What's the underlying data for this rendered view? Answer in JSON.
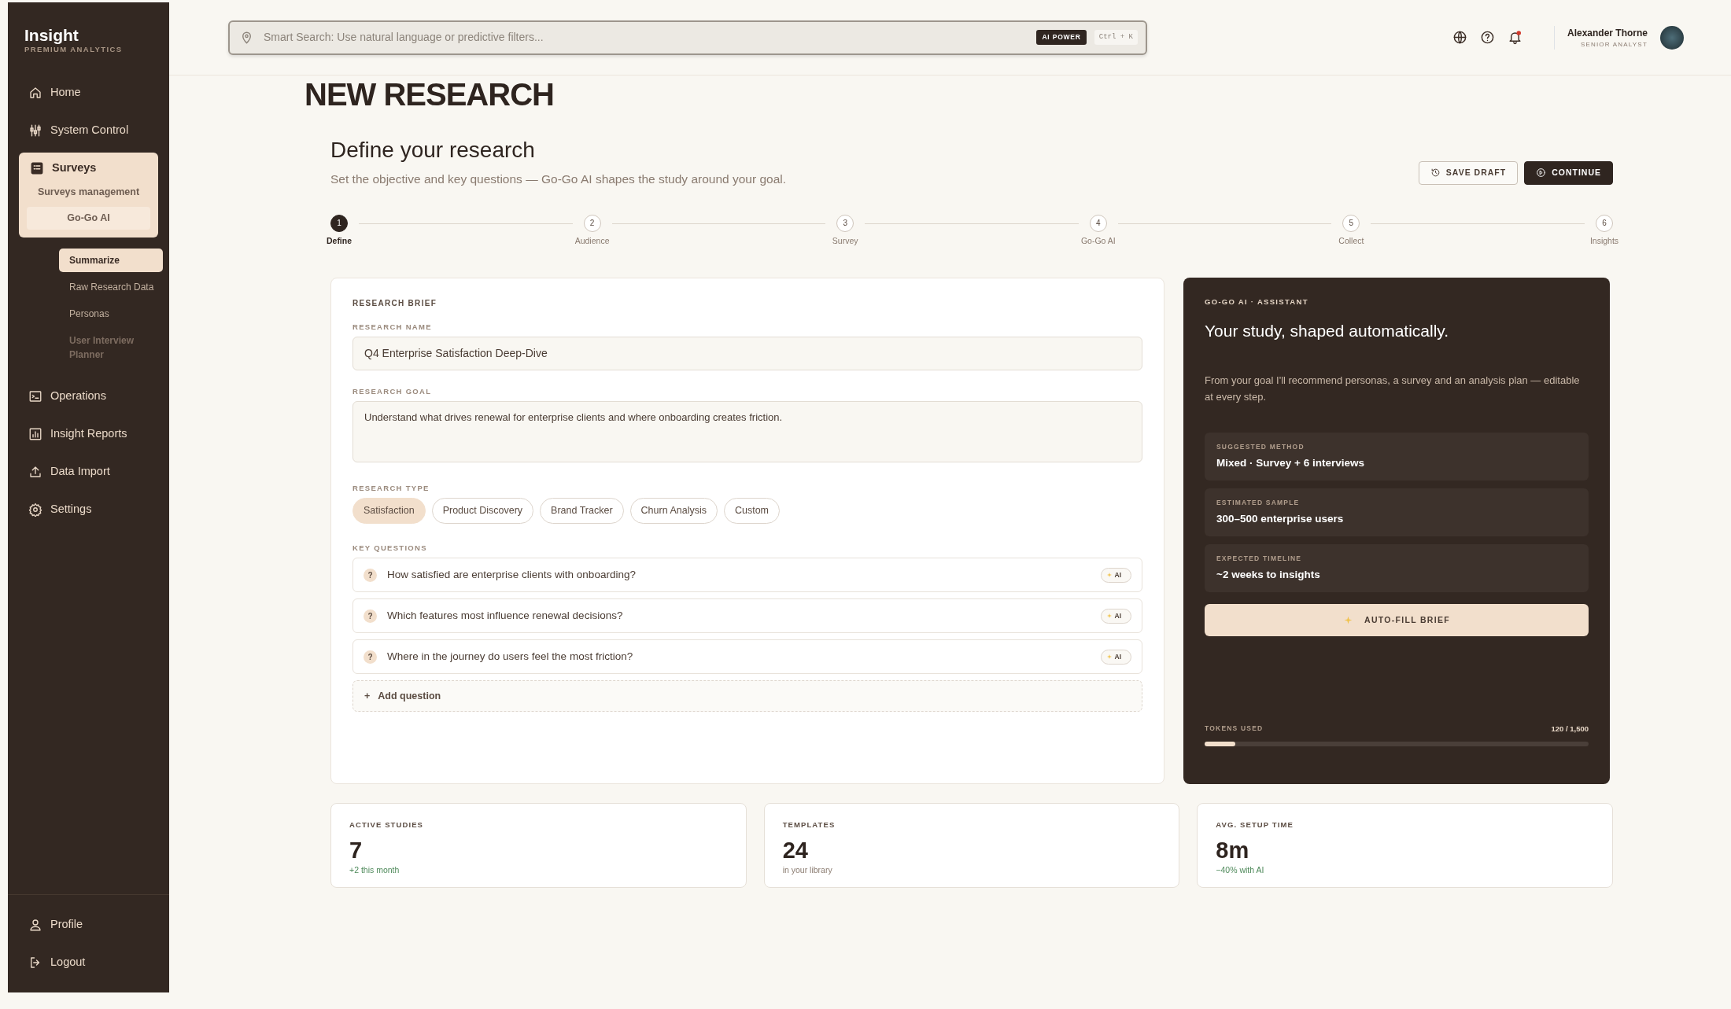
{
  "sidebar": {
    "brand": "Insight",
    "tagline": "PREMIUM ANALYTICS",
    "items": [
      {
        "label": "Home",
        "selected": false
      },
      {
        "label": "System Control",
        "selected": false
      },
      {
        "label": "Surveys",
        "selected": true,
        "expanded": true,
        "children": [
          {
            "label": "Surveys management",
            "selected": false
          },
          {
            "label": "Go-Go AI",
            "selected": true
          }
        ],
        "tools": [
          {
            "label": "Summarize",
            "selected": true,
            "disabled": false
          },
          {
            "label": "Raw Research Data",
            "selected": false,
            "disabled": false
          },
          {
            "label": "Personas",
            "selected": false,
            "disabled": false
          },
          {
            "label": "User Interview Planner",
            "selected": false,
            "disabled": true
          }
        ]
      },
      {
        "label": "Operations",
        "selected": false
      },
      {
        "label": "Insight Reports",
        "selected": false
      },
      {
        "label": "Data Import",
        "selected": false
      },
      {
        "label": "Settings",
        "selected": false
      }
    ],
    "footer_items": [
      {
        "label": "Profile"
      },
      {
        "label": "Logout"
      }
    ]
  },
  "top_bar": {
    "search": {
      "placeholder": "Smart Search: Use natural language or predictive filters...",
      "badge": "AI POWER",
      "shortcut": "Ctrl + K"
    },
    "notifications": true,
    "user": {
      "name": "Alexander Thorne",
      "role": "SENIOR ANALYST"
    }
  },
  "page_title": "NEW RESEARCH",
  "header": {
    "title": "Define your research",
    "subtitle": "Set the objective and key questions — Go-Go AI shapes the study around your goal.",
    "buttons": [
      {
        "label": "SAVE DRAFT",
        "kind": "secondary"
      },
      {
        "label": "CONTINUE",
        "kind": "primary"
      }
    ]
  },
  "steps": [
    {
      "number": "1",
      "label": "Define",
      "selected": true
    },
    {
      "number": "2",
      "label": "Audience",
      "selected": false
    },
    {
      "number": "3",
      "label": "Survey",
      "selected": false
    },
    {
      "number": "4",
      "label": "Go-Go AI",
      "selected": false
    },
    {
      "number": "5",
      "label": "Collect",
      "selected": false
    },
    {
      "number": "6",
      "label": "Insights",
      "selected": false
    }
  ],
  "brief": {
    "title": "RESEARCH BRIEF",
    "name_label": "RESEARCH NAME",
    "name_value": "Q4 Enterprise Satisfaction Deep-Dive",
    "goal_label": "RESEARCH GOAL",
    "goal_value": "Understand what drives renewal for enterprise clients and where onboarding creates friction.",
    "type_label": "RESEARCH TYPE",
    "types": [
      {
        "label": "Satisfaction",
        "selected": true
      },
      {
        "label": "Product Discovery",
        "selected": false
      },
      {
        "label": "Brand Tracker",
        "selected": false
      },
      {
        "label": "Churn Analysis",
        "selected": false
      },
      {
        "label": "Custom",
        "selected": false
      }
    ],
    "questions_label": "KEY QUESTIONS",
    "questions": [
      {
        "mark": "?",
        "text": "How satisfied are enterprise clients with onboarding?",
        "badge": "AI"
      },
      {
        "mark": "?",
        "text": "Which features most influence renewal decisions?",
        "badge": "AI"
      },
      {
        "mark": "?",
        "text": "Where in the journey do users feel the most friction?",
        "badge": "AI"
      }
    ],
    "add_button": {
      "symbol": "+",
      "label": "Add question"
    }
  },
  "assistant": {
    "eyebrow": "GO-GO AI · ASSISTANT",
    "title": "Your study, shaped automatically.",
    "description": "From your goal I'll recommend personas, a survey and an analysis plan — editable at every step.",
    "facts": [
      {
        "label": "SUGGESTED METHOD",
        "value": "Mixed · Survey + 6 interviews"
      },
      {
        "label": "ESTIMATED SAMPLE",
        "value": "300–500 enterprise users"
      },
      {
        "label": "EXPECTED TIMELINE",
        "value": "~2 weeks to insights"
      }
    ],
    "action": "AUTO-FILL BRIEF",
    "tokens_label": "TOKENS USED",
    "tokens_reading": "120 / 1,500",
    "tokens": {
      "level": 0.08
    }
  },
  "stats": [
    {
      "label": "ACTIVE STUDIES",
      "value": "7",
      "note": "+2 this month",
      "positive": true
    },
    {
      "label": "TEMPLATES",
      "value": "24",
      "note": "in your library",
      "positive": false
    },
    {
      "label": "AVG. SETUP TIME",
      "value": "8m",
      "note": "−40% with AI",
      "positive": true
    }
  ]
}
